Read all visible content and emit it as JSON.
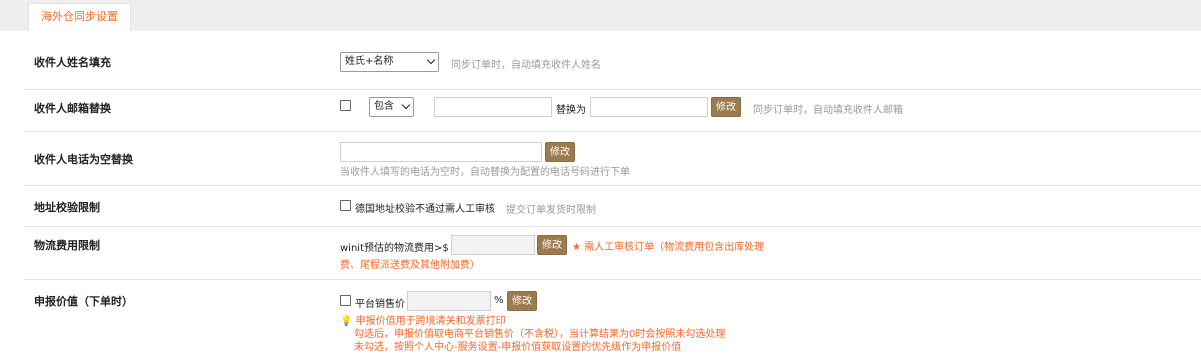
{
  "tab": {
    "label": "海外仓同步设置"
  },
  "rows": {
    "name_fill": {
      "label": "收件人姓名填充",
      "select_value": "姓氏+名称",
      "hint": "同步订单时，自动填充收件人姓名"
    },
    "email_replace": {
      "label": "收件人邮箱替换",
      "select_value": "包含",
      "replace_label": "替换为",
      "button": "修改",
      "hint": "同步订单时，自动填充收件人邮箱"
    },
    "phone_replace": {
      "label": "收件人电话为空替换",
      "button": "修改",
      "hint": "当收件人填写的电话为空时，自动替换为配置的电话号码进行下单"
    },
    "address_check": {
      "label": "地址校验限制",
      "checkbox_label": "德国地址校验不通过需人工审核",
      "hint": "提交订单发货时限制"
    },
    "logistics_fee": {
      "label": "物流费用限制",
      "prefix": "winit预估的物流费用>$",
      "button": "修改",
      "note_line1": "需人工审核订单（物流费用包含出库处理",
      "note_line2": "费、尾程派送费及其他附加费）"
    },
    "declared_value": {
      "label": "申报价值（下单时）",
      "checkbox_label": "平台销售价",
      "percent": "%",
      "button": "修改",
      "note_line1": "申报价值用于跨境清关和发票打印",
      "note_line2": "勾选后，申报价值取电商平台销售价（不含税），当计算结果为0时会按照未勾选处理",
      "note_line3": "未勾选，按照个人中心-服务设置-申报价值获取设置的优先级作为申报价值"
    }
  },
  "icons": {
    "star": "star-icon",
    "bulb": "lightbulb-icon",
    "caret": "chevron-down-icon"
  },
  "colors": {
    "accent": "#f06a2b",
    "button": "#9c7b4e",
    "tabbar": "#eeeeee"
  }
}
